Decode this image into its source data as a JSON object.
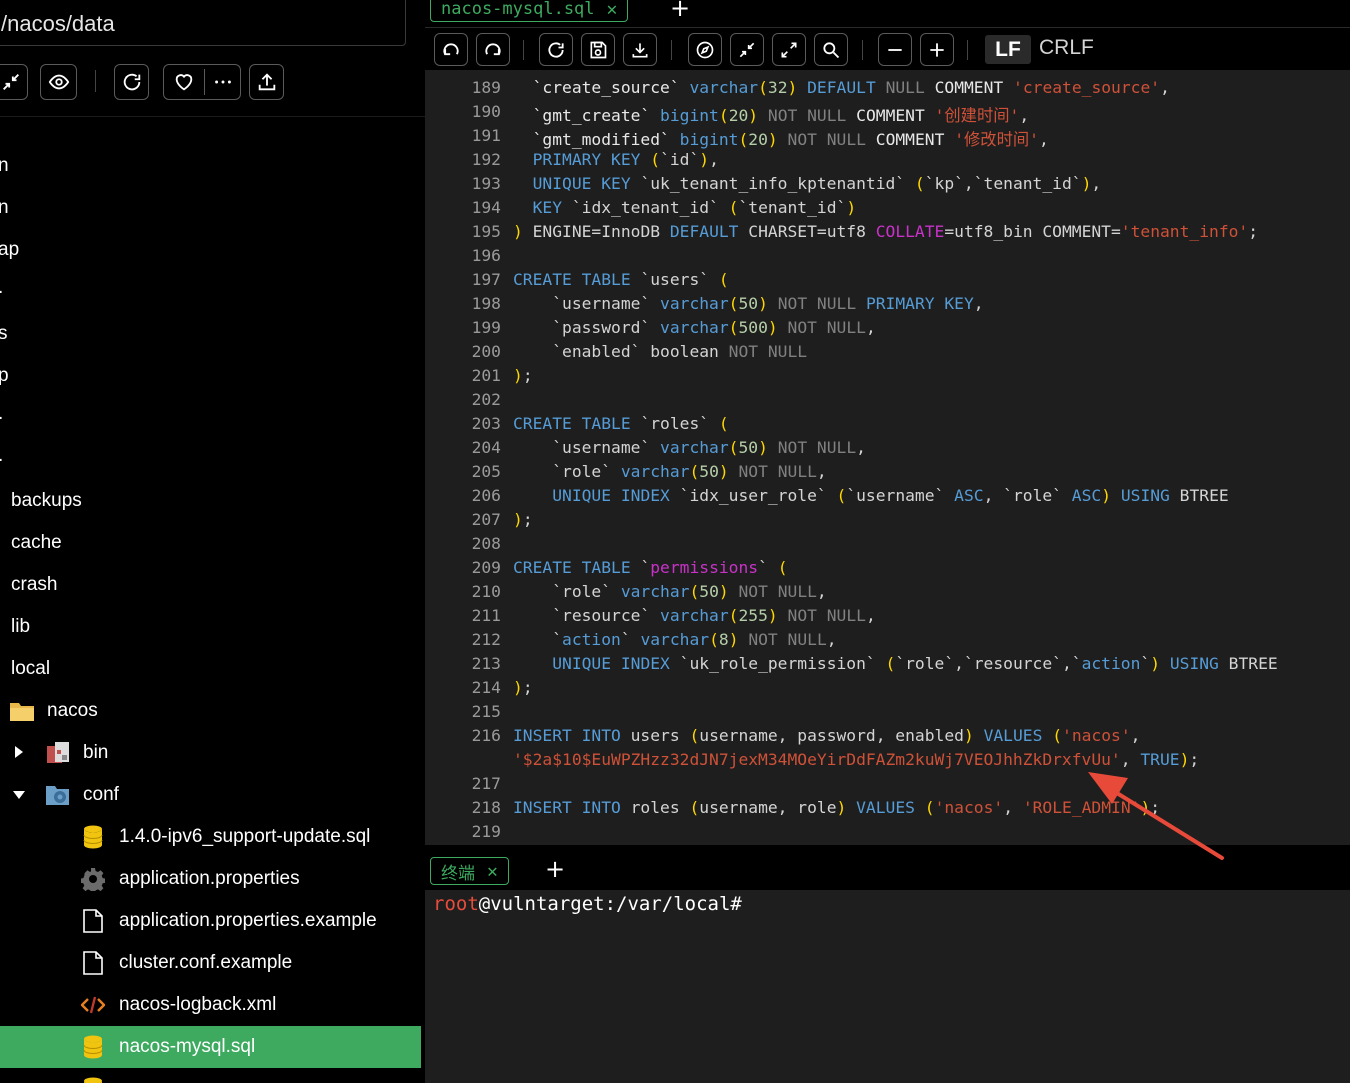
{
  "sidebar": {
    "path": "/nacos/data",
    "cut_names": [
      "n",
      "n",
      "ap",
      ".",
      "s",
      "p",
      ".",
      "."
    ],
    "folders": [
      "backups",
      "cache",
      "crash",
      "lib",
      "local",
      "nacos",
      "bin",
      "conf"
    ],
    "files": [
      "1.4.0-ipv6_support-update.sql",
      "application.properties",
      "application.properties.example",
      "cluster.conf.example",
      "nacos-logback.xml",
      "nacos-mysql.sql"
    ]
  },
  "editor": {
    "tab_label": "nacos-mysql.sql",
    "tab_close": "✕",
    "new_tab": "+",
    "eol_lf": "LF",
    "eol_crlf": "CRLF"
  },
  "code_lines": [
    {
      "n": "189",
      "t": "  `create_source` varchar(32) DEFAULT NULL COMMENT 'create_source',"
    },
    {
      "n": "190",
      "t": "  `gmt_create` bigint(20) NOT NULL COMMENT '创建时间',"
    },
    {
      "n": "191",
      "t": "  `gmt_modified` bigint(20) NOT NULL COMMENT '修改时间',"
    },
    {
      "n": "192",
      "t": "  PRIMARY KEY (`id`),"
    },
    {
      "n": "193",
      "t": "  UNIQUE KEY `uk_tenant_info_kptenantid` (`kp`,`tenant_id`),"
    },
    {
      "n": "194",
      "t": "  KEY `idx_tenant_id` (`tenant_id`)"
    },
    {
      "n": "195",
      "t": ") ENGINE=InnoDB DEFAULT CHARSET=utf8 COLLATE=utf8_bin COMMENT='tenant_info';"
    },
    {
      "n": "196",
      "t": ""
    },
    {
      "n": "197",
      "t": "CREATE TABLE `users` ("
    },
    {
      "n": "198",
      "t": "    `username` varchar(50) NOT NULL PRIMARY KEY,"
    },
    {
      "n": "199",
      "t": "    `password` varchar(500) NOT NULL,"
    },
    {
      "n": "200",
      "t": "    `enabled` boolean NOT NULL"
    },
    {
      "n": "201",
      "t": ");"
    },
    {
      "n": "202",
      "t": ""
    },
    {
      "n": "203",
      "t": "CREATE TABLE `roles` ("
    },
    {
      "n": "204",
      "t": "    `username` varchar(50) NOT NULL,"
    },
    {
      "n": "205",
      "t": "    `role` varchar(50) NOT NULL,"
    },
    {
      "n": "206",
      "t": "    UNIQUE INDEX `idx_user_role` (`username` ASC, `role` ASC) USING BTREE"
    },
    {
      "n": "207",
      "t": ");"
    },
    {
      "n": "208",
      "t": ""
    },
    {
      "n": "209",
      "t": "CREATE TABLE `permissions` ("
    },
    {
      "n": "210",
      "t": "    `role` varchar(50) NOT NULL,"
    },
    {
      "n": "211",
      "t": "    `resource` varchar(255) NOT NULL,"
    },
    {
      "n": "212",
      "t": "    `action` varchar(8) NOT NULL,"
    },
    {
      "n": "213",
      "t": "    UNIQUE INDEX `uk_role_permission` (`role`,`resource`,`action`) USING BTREE"
    },
    {
      "n": "214",
      "t": ");"
    },
    {
      "n": "215",
      "t": ""
    },
    {
      "n": "216",
      "t": "INSERT INTO users (username, password, enabled) VALUES ('nacos',"
    },
    {
      "n": "",
      "t": "'$2a$10$EuWPZHzz32dJN7jexM34MOeYirDdFAZm2kuWj7VEOJhhZkDrxfvUu', TRUE);"
    },
    {
      "n": "217",
      "t": ""
    },
    {
      "n": "218",
      "t": "INSERT INTO roles (username, role) VALUES ('nacos', 'ROLE_ADMIN');"
    },
    {
      "n": "219",
      "t": ""
    }
  ],
  "terminal": {
    "tab_label": "终端",
    "tab_close": "✕",
    "new_tab": "+",
    "prompt_user": "root",
    "prompt_rest": "@vulntarget:/var/local#"
  },
  "colors": {
    "accent_green": "#3daa60",
    "annotation_arrow": "#e84a3a"
  }
}
